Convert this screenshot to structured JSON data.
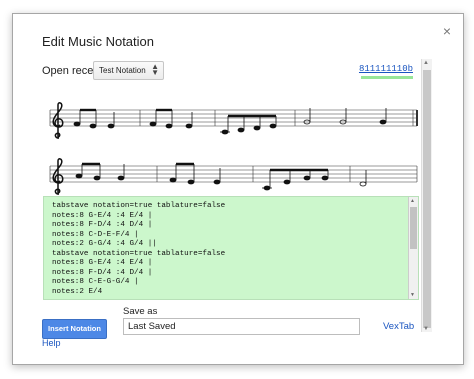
{
  "dialog": {
    "title": "Edit Music Notation",
    "close_symbol": "×",
    "open_recent_label": "Open recent",
    "open_recent_selected": "Test Notation",
    "version_hash": "811111110b",
    "insert_button": "Insert Notation",
    "help_link": "Help",
    "save_as_label": "Save as",
    "save_as_value": "Last Saved",
    "vextab_link": "VexTab"
  },
  "editor": {
    "lines": [
      "tabstave notation=true tablature=false",
      "notes:8 G-E/4 :4 E/4 |",
      "notes:8 F-D/4 :4 D/4 |",
      "notes:8 C-D-E-F/4 |",
      "notes:2 G-G/4 :4 G/4 ||",
      "tabstave notation=true tablature=false",
      "notes:8 G-E/4 :4 E/4 |",
      "notes:8 F-D/4 :4 D/4 |",
      "notes:8 C-E-G-G/4 |",
      "notes:2 E/4"
    ]
  },
  "colors": {
    "accent_blue": "#4d88e6",
    "editor_bg": "#ccf7cc",
    "link": "#1a55c0"
  }
}
